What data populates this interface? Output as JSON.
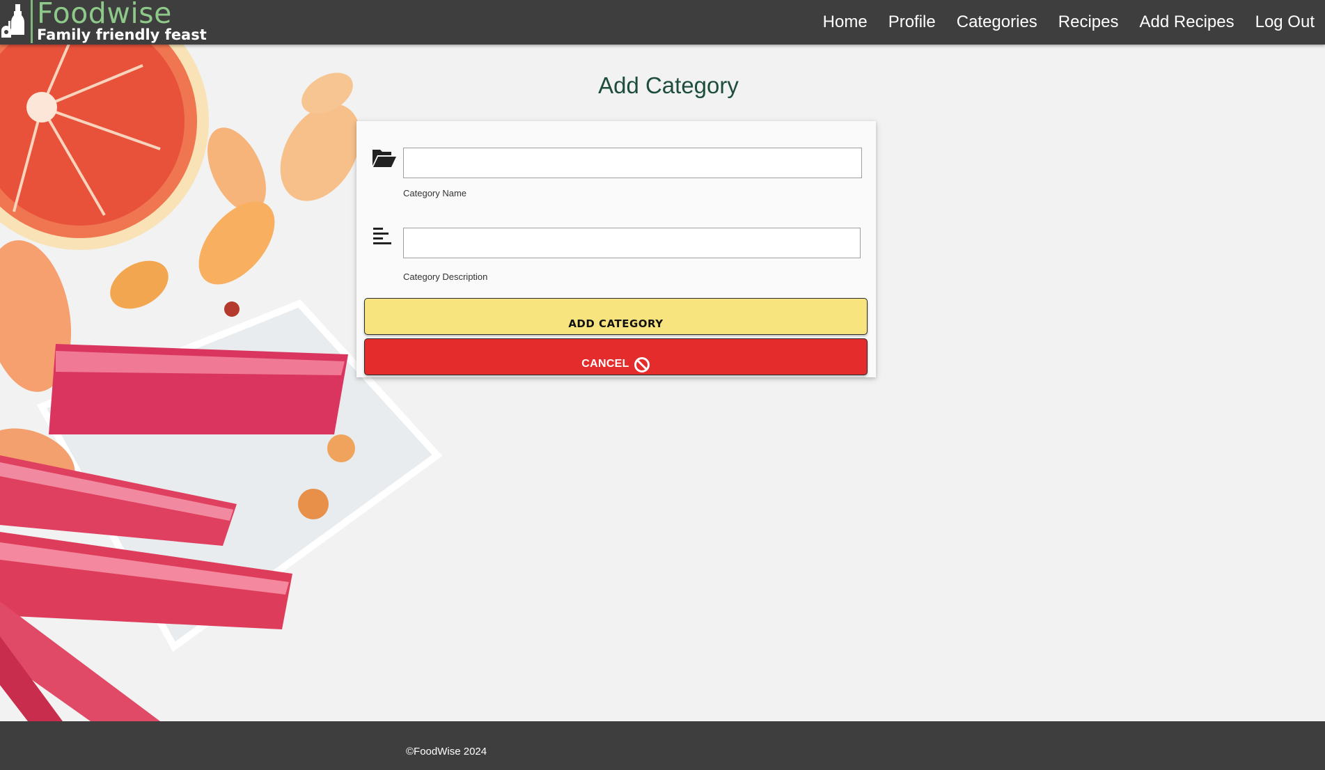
{
  "brand": {
    "name": "Foodwise",
    "tagline": "Family friendly feast"
  },
  "nav": {
    "items": [
      {
        "label": "Home"
      },
      {
        "label": "Profile"
      },
      {
        "label": "Categories"
      },
      {
        "label": "Recipes"
      },
      {
        "label": "Add Recipes"
      },
      {
        "label": "Log Out"
      }
    ]
  },
  "page": {
    "title": "Add Category"
  },
  "form": {
    "category_name": {
      "value": "",
      "helper": "Category Name",
      "icon": "folder-open-icon"
    },
    "category_description": {
      "value": "",
      "helper": "Category Description",
      "icon": "align-left-icon"
    },
    "add_button": "ADD CATEGORY",
    "cancel_button": "CANCEL",
    "cancel_icon": "block-icon"
  },
  "footer": {
    "text": "©FoodWise 2024"
  },
  "colors": {
    "navbar": "#3e3e3e",
    "brand_green": "#8fc98a",
    "title_green": "#1e4d3b",
    "add_button": "#f8e47f",
    "cancel_button": "#e32c2b",
    "background": "#f1f2f1"
  }
}
